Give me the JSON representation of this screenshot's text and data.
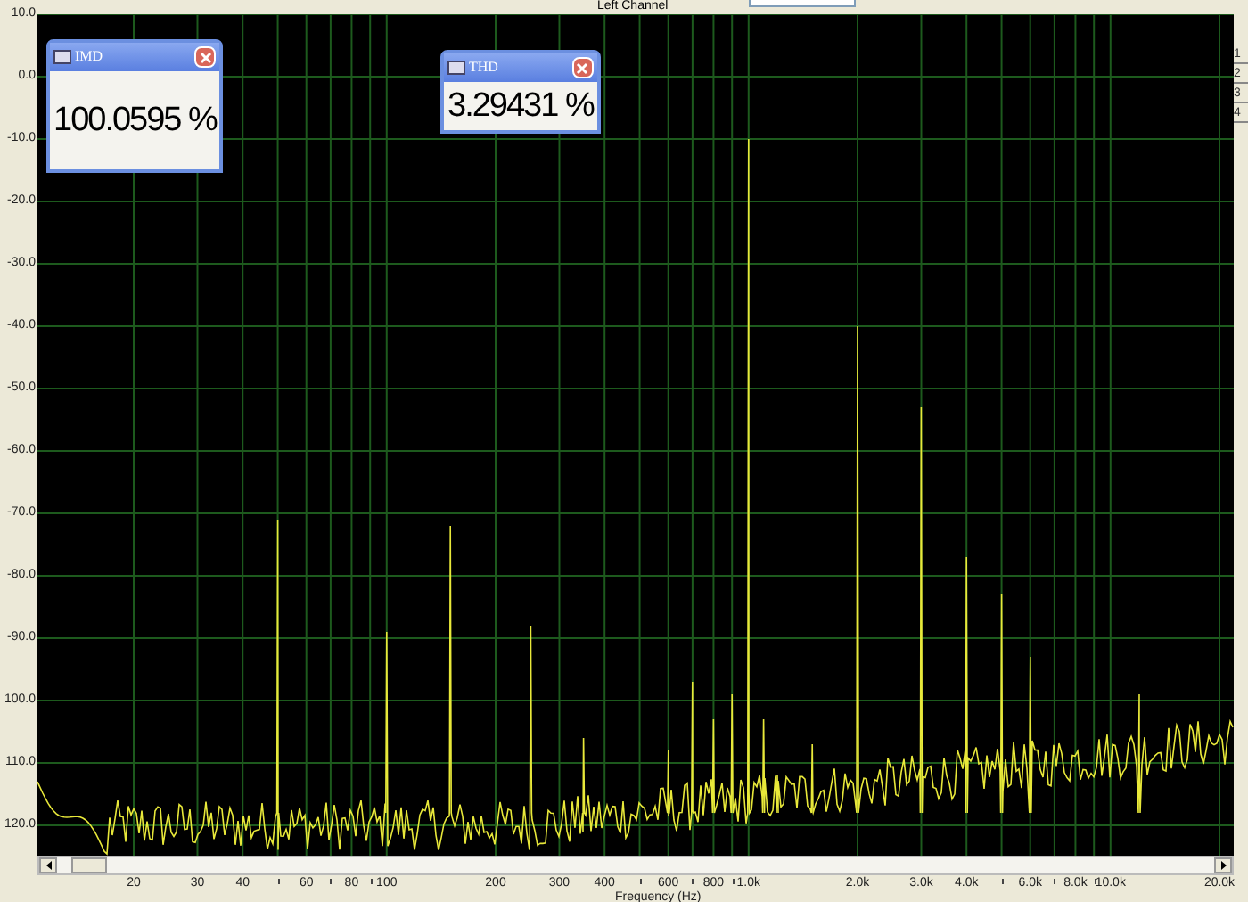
{
  "header": {
    "title": "Left Channel"
  },
  "readouts": [
    {
      "title": "IMD",
      "value": "100.0595 %"
    },
    {
      "title": "THD",
      "value": "3.29431 %"
    }
  ],
  "y_axis": {
    "labels": [
      "10.0",
      "0.0",
      "-10.0",
      "-20.0",
      "-30.0",
      "-40.0",
      "-50.0",
      "-60.0",
      "-70.0",
      "-80.0",
      "-90.0",
      "100.0",
      "110.0",
      "120.0"
    ]
  },
  "x_axis": {
    "labels": [
      "20",
      "30",
      "40",
      "60",
      "80",
      "100",
      "200",
      "300",
      "400",
      "600",
      "800",
      "1.0k",
      "2.0k",
      "3.0k",
      "4.0k",
      "6.0k",
      "8.0k",
      "10.0k",
      "20.0k"
    ],
    "title": "Frequency (Hz)"
  },
  "side_buttons": [
    "1",
    "2",
    "3",
    "4"
  ]
}
